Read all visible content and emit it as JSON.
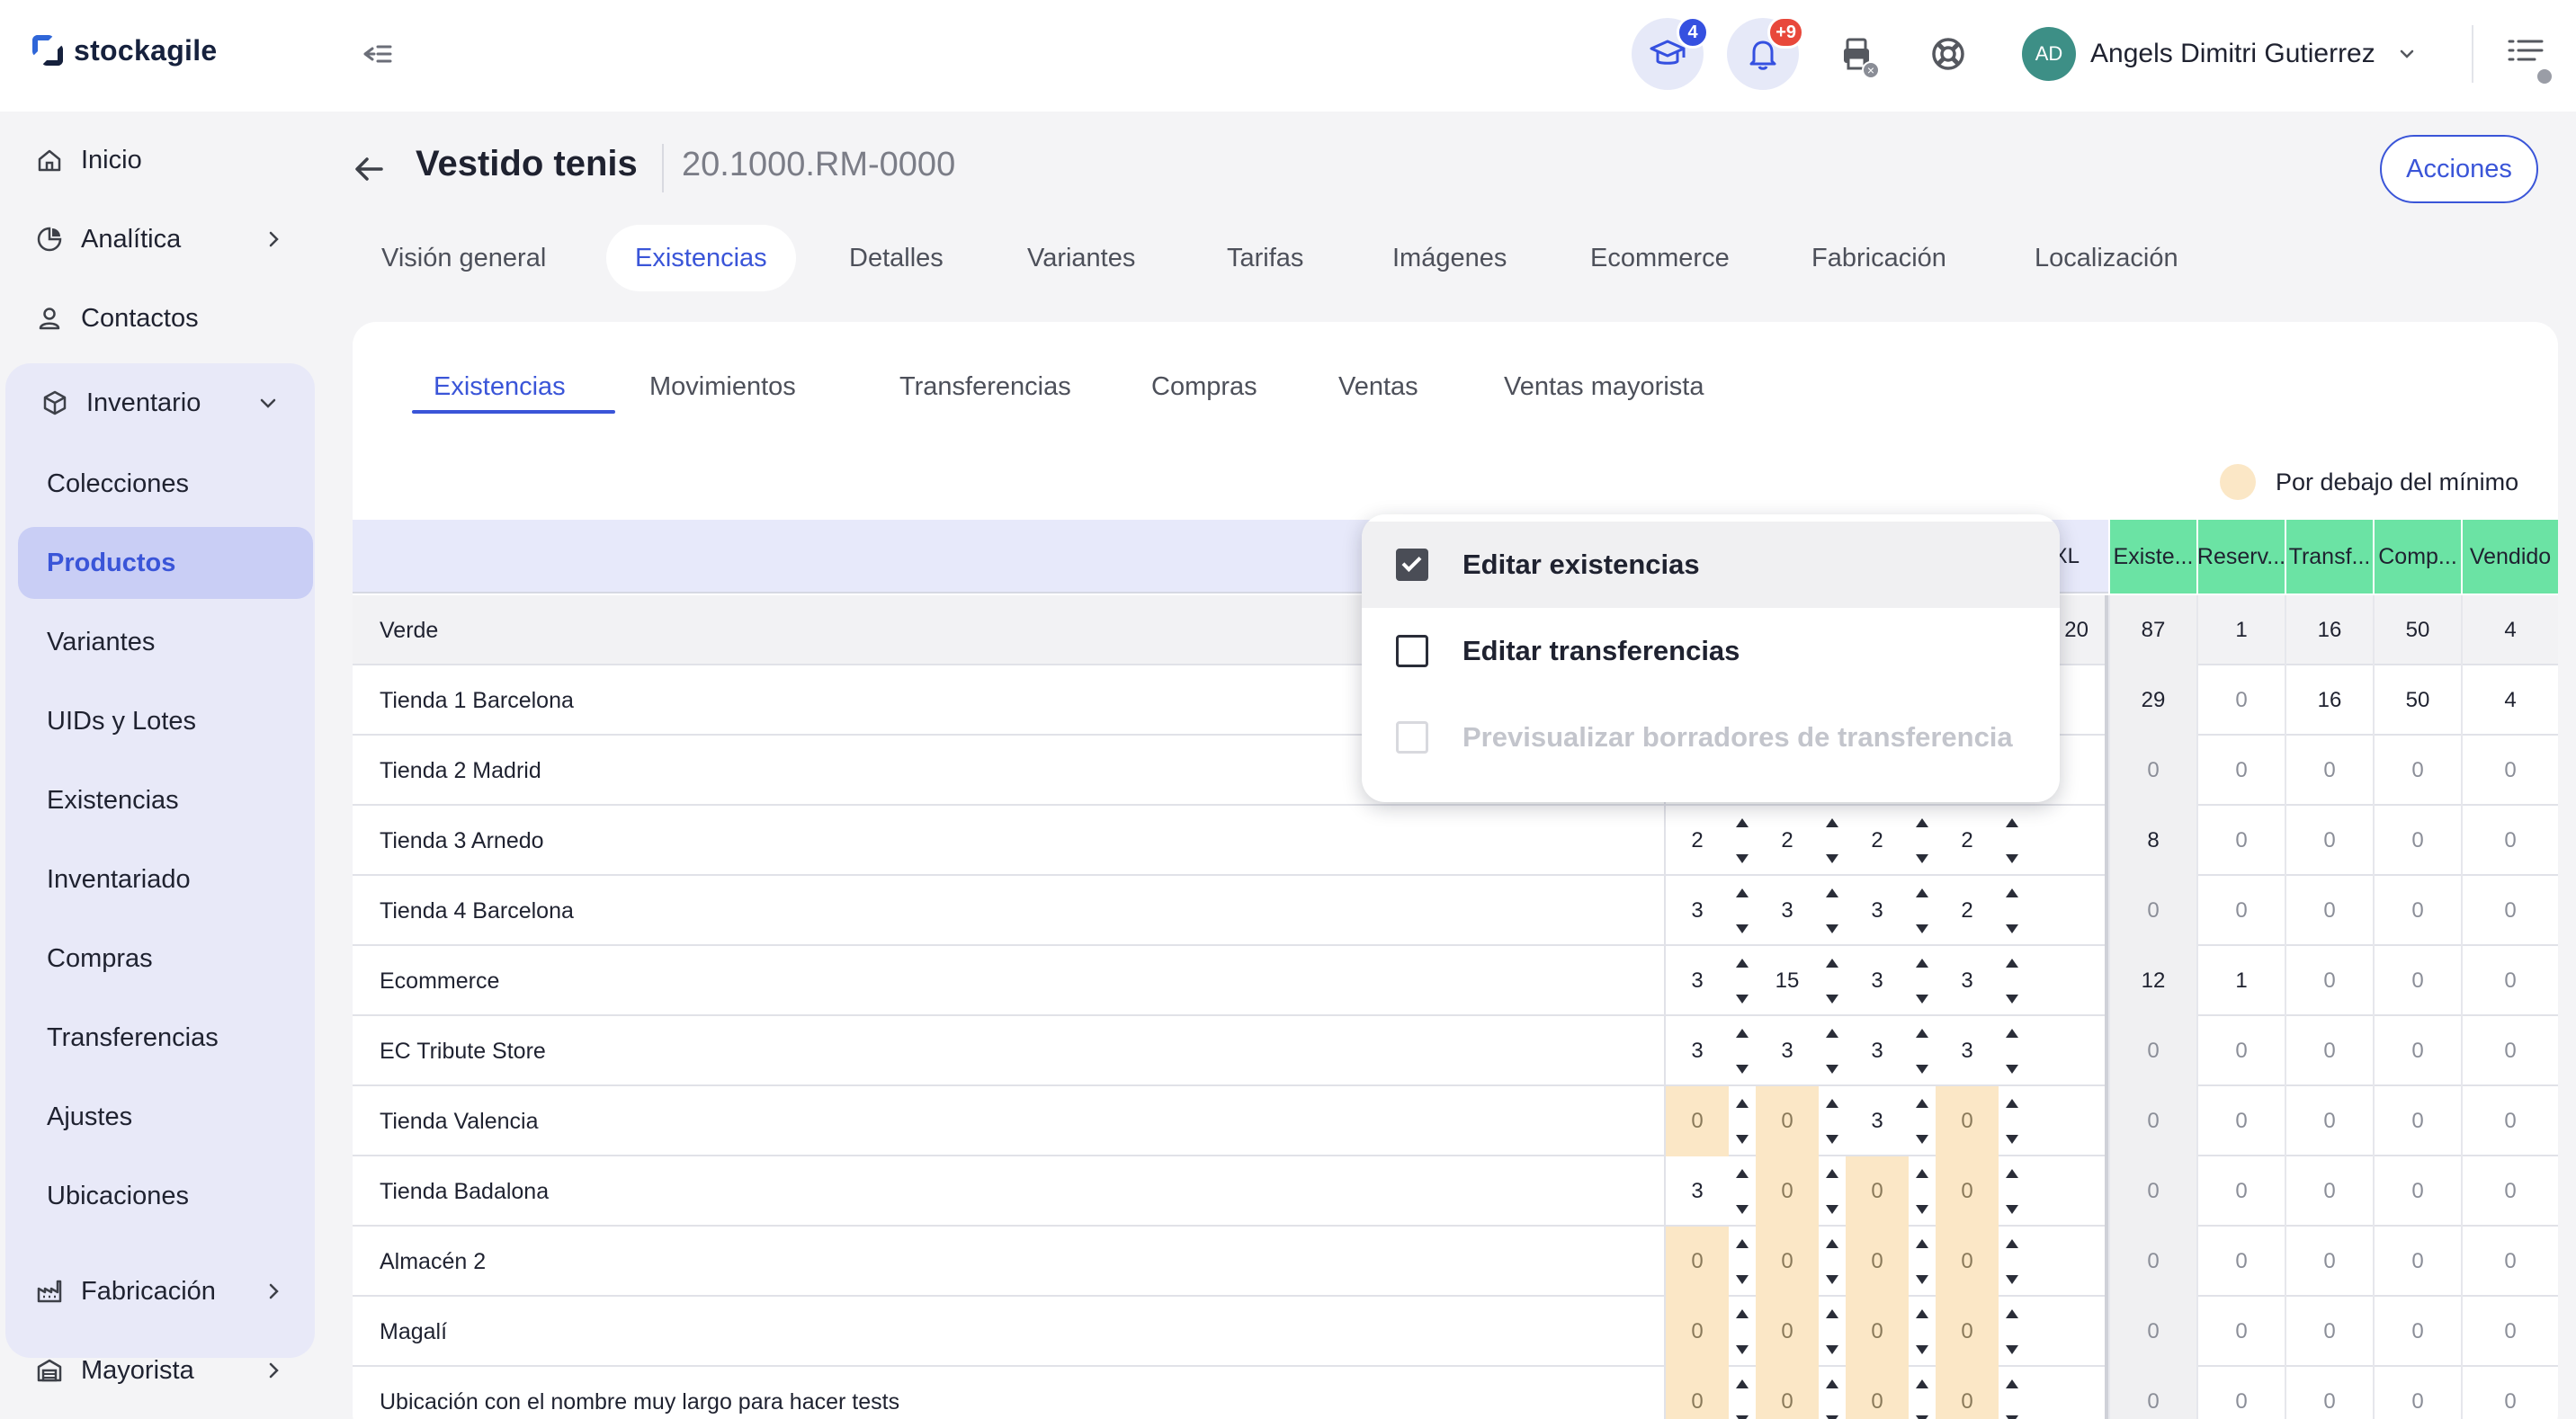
{
  "brand": {
    "name": "stockagile",
    "accent": "#3a55d8",
    "total_header_color": "#6be3a4",
    "low_stock_color": "#fbe7c6"
  },
  "topbar": {
    "academy_badge": "4",
    "notifications_badge": "+9",
    "user_initials": "AD",
    "user_name": "Angels Dimitri Gutierrez"
  },
  "sidebar": {
    "top_items": [
      {
        "label": "Inicio",
        "icon": "home-icon"
      },
      {
        "label": "Analítica",
        "icon": "analytics-icon"
      },
      {
        "label": "Contactos",
        "icon": "user-icon"
      }
    ],
    "inventory": {
      "label": "Inventario",
      "icon": "box-icon",
      "children": [
        "Colecciones",
        "Productos",
        "Variantes",
        "UIDs y Lotes",
        "Existencias",
        "Inventariado",
        "Compras",
        "Transferencias",
        "Ajustes",
        "Ubicaciones"
      ],
      "active": "Productos"
    },
    "bottom_items": [
      {
        "label": "Fabricación",
        "icon": "factory-icon"
      },
      {
        "label": "Mayorista",
        "icon": "warehouse-icon"
      }
    ]
  },
  "page": {
    "title": "Vestido tenis",
    "code": "20.1000.RM-0000",
    "actions_label": "Acciones"
  },
  "main_tabs": [
    "Visión general",
    "Existencias",
    "Detalles",
    "Variantes",
    "Tarifas",
    "Imágenes",
    "Ecommerce",
    "Fabricación",
    "Localización"
  ],
  "main_tab_active": "Existencias",
  "sub_tabs": [
    "Existencias",
    "Movimientos",
    "Transferencias",
    "Compras",
    "Ventas",
    "Ventas mayorista"
  ],
  "sub_tab_active": "Existencias",
  "legend": {
    "below_min": "Por debajo del mínimo"
  },
  "table": {
    "size_header_partial": "XL",
    "group_partial_value": "20",
    "total_headers": [
      "Existe...",
      "Reserv...",
      "Transf...",
      "Comp...",
      "Vendido"
    ],
    "group": {
      "name": "Verde",
      "totals": [
        "87",
        "1",
        "16",
        "50",
        "4"
      ]
    },
    "rows": [
      {
        "name": "Tienda 1 Barcelona",
        "sizes": null,
        "totals": [
          "29",
          "0",
          "16",
          "50",
          "4"
        ]
      },
      {
        "name": "Tienda 2 Madrid",
        "sizes": null,
        "totals": [
          "0",
          "0",
          "0",
          "0",
          "0"
        ]
      },
      {
        "name": "Tienda 3 Arnedo",
        "sizes": [
          "2",
          "2",
          "2",
          "2"
        ],
        "totals": [
          "8",
          "0",
          "0",
          "0",
          "0"
        ]
      },
      {
        "name": "Tienda 4 Barcelona",
        "sizes": [
          "3",
          "3",
          "3",
          "2"
        ],
        "totals": [
          "0",
          "0",
          "0",
          "0",
          "0"
        ]
      },
      {
        "name": "Ecommerce",
        "sizes": [
          "3",
          "15",
          "3",
          "3"
        ],
        "totals": [
          "12",
          "1",
          "0",
          "0",
          "0"
        ]
      },
      {
        "name": "EC Tribute Store",
        "sizes": [
          "3",
          "3",
          "3",
          "3"
        ],
        "totals": [
          "0",
          "0",
          "0",
          "0",
          "0"
        ]
      },
      {
        "name": "Tienda Valencia",
        "sizes": [
          "0",
          "0",
          "3",
          "0"
        ],
        "totals": [
          "0",
          "0",
          "0",
          "0",
          "0"
        ]
      },
      {
        "name": "Tienda Badalona",
        "sizes": [
          "3",
          "0",
          "0",
          "0"
        ],
        "totals": [
          "0",
          "0",
          "0",
          "0",
          "0"
        ]
      },
      {
        "name": "Almacén 2",
        "sizes": [
          "0",
          "0",
          "0",
          "0"
        ],
        "totals": [
          "0",
          "0",
          "0",
          "0",
          "0"
        ]
      },
      {
        "name": "Magalí",
        "sizes": [
          "0",
          "0",
          "0",
          "0"
        ],
        "totals": [
          "0",
          "0",
          "0",
          "0",
          "0"
        ]
      },
      {
        "name": "Ubicación con el nombre muy largo para hacer tests",
        "sizes": [
          "0",
          "0",
          "0",
          "0"
        ],
        "totals": [
          "0",
          "0",
          "0",
          "0",
          "0"
        ]
      }
    ]
  },
  "popover": {
    "items": [
      {
        "label": "Editar existencias",
        "checked": true,
        "disabled": false
      },
      {
        "label": "Editar transferencias",
        "checked": false,
        "disabled": false
      },
      {
        "label": "Previsualizar borradores de transferencia",
        "checked": false,
        "disabled": true
      }
    ]
  }
}
